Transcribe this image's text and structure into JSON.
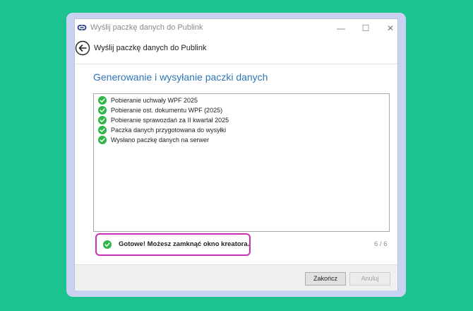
{
  "window": {
    "title": "Wyślij paczkę danych do Publink",
    "controls": {
      "minimize": "—",
      "maximize": "☐",
      "close": "✕"
    }
  },
  "header": {
    "text": "Wyślij paczkę danych do Publink"
  },
  "section": {
    "title": "Generowanie i wysyłanie paczki danych"
  },
  "log": {
    "items": [
      {
        "label": "Pobieranie uchwały WPF 2025",
        "status": "done"
      },
      {
        "label": "Pobieranie ost. dokumentu WPF (2025)",
        "status": "done"
      },
      {
        "label": "Pobieranie sprawozdań za II kwartał 2025",
        "status": "done"
      },
      {
        "label": "Paczka danych przygotowana do wysyłki",
        "status": "done"
      },
      {
        "label": "Wysłano paczkę danych na serwer",
        "status": "done"
      }
    ]
  },
  "status": {
    "message": "Gotowe! Możesz zamknąć okno kreatora.",
    "step": "6 / 6"
  },
  "footer": {
    "finish_label": "Zakończ",
    "cancel_label": "Anuluj"
  },
  "colors": {
    "background": "#1cc38f",
    "accent": "#2e74b5",
    "success": "#2fb548",
    "highlight": "#cc2fb3"
  },
  "icons": {
    "app": "link-icon",
    "back": "back-arrow-icon",
    "check": "check-circle-icon"
  }
}
